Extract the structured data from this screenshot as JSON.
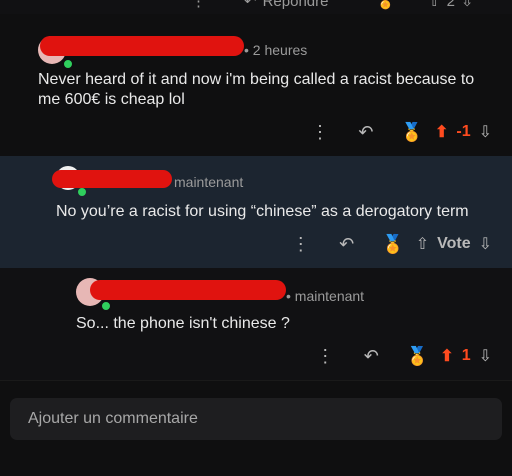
{
  "top_actions": {
    "reply_label": "Répondre",
    "vote_count": "2"
  },
  "comments": [
    {
      "time": "2 heures",
      "text": "Never heard of it and now i'm being called a racist because to me 600€ is cheap lol",
      "score": "-1"
    },
    {
      "time": "maintenant",
      "text": "No you’re a racist for using “chinese” as a derogatory term",
      "vote_label": "Vote"
    },
    {
      "time": "maintenant",
      "text": "So... the phone isn't chinese ?",
      "score": "1"
    }
  ],
  "composer": {
    "placeholder": "Ajouter un commentaire"
  },
  "colors": {
    "upvote_active": "#ff4b1f",
    "reply_bg": "#1c2530",
    "online": "#2fcf5d"
  }
}
